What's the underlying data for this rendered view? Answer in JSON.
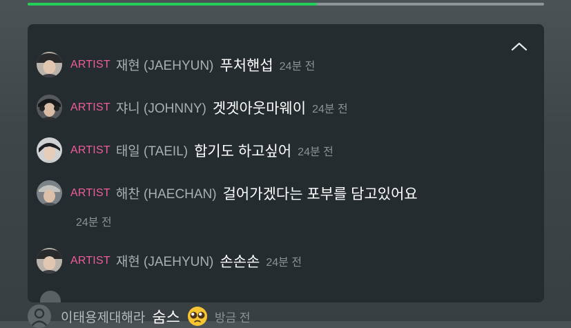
{
  "progress": {
    "value_percent": 56,
    "fill_color": "#22d05a"
  },
  "panel": {
    "collapse_icon": "chevron-up-icon",
    "messages": [
      {
        "badge": "ARTIST",
        "name": "재현 (JAEHYUN)",
        "text": "푸처핸섭",
        "time": "24분 전",
        "avatar": "jaehyun"
      },
      {
        "badge": "ARTIST",
        "name": "쟈니 (JOHNNY)",
        "text": "겟겟아웃마웨이",
        "time": "24분 전",
        "avatar": "johnny"
      },
      {
        "badge": "ARTIST",
        "name": "태일 (TAEIL)",
        "text": "합기도 하고싶어",
        "time": "24분 전",
        "avatar": "taeil"
      },
      {
        "badge": "ARTIST",
        "name": "해찬 (HAECHAN)",
        "text": "걸어가겠다는 포부를 담고있어요",
        "time": "24분 전",
        "avatar": "haechan"
      },
      {
        "badge": "ARTIST",
        "name": "재현 (JAEHYUN)",
        "text": "손손손",
        "time": "24분 전",
        "avatar": "jaehyun"
      }
    ]
  },
  "footer_comment": {
    "name": "이태용제대해라",
    "text": "숨스",
    "emoji": "pleading-face-emoji",
    "time": "방금 전"
  },
  "colors": {
    "badge": "#ee5e9b",
    "panel_background": "#252c2f"
  }
}
